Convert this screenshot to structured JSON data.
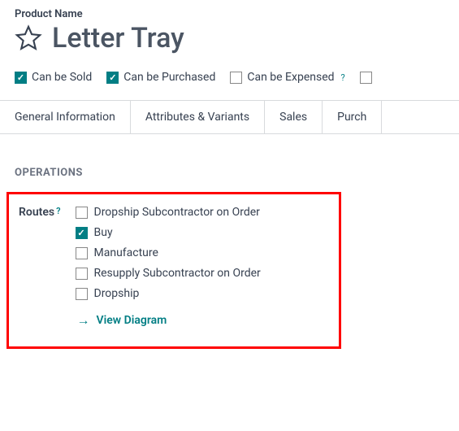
{
  "header": {
    "field_label": "Product Name",
    "title": "Letter Tray"
  },
  "options": {
    "can_be_sold": {
      "label": "Can be Sold",
      "checked": true
    },
    "can_be_purchased": {
      "label": "Can be Purchased",
      "checked": true
    },
    "can_be_expensed": {
      "label": "Can be Expensed",
      "checked": false
    }
  },
  "tabs": {
    "general": "General Information",
    "attributes": "Attributes & Variants",
    "sales": "Sales",
    "purchase": "Purch"
  },
  "operations": {
    "heading": "OPERATIONS",
    "routes_label": "Routes",
    "routes": {
      "dropship_sub_order": {
        "label": "Dropship Subcontractor on Order",
        "checked": false
      },
      "buy": {
        "label": "Buy",
        "checked": true
      },
      "manufacture": {
        "label": "Manufacture",
        "checked": false
      },
      "resupply_sub_order": {
        "label": "Resupply Subcontractor on Order",
        "checked": false
      },
      "dropship": {
        "label": "Dropship",
        "checked": false
      }
    },
    "view_diagram": "View Diagram"
  },
  "help": "?"
}
